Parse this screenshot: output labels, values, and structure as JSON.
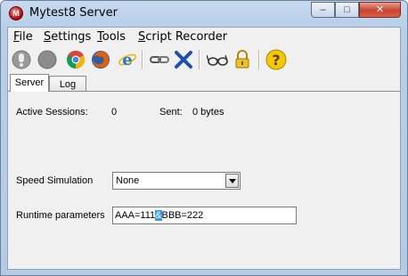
{
  "window": {
    "title": "Mytest8 Server",
    "icon_letter": "M",
    "controls": {
      "minimize": "–",
      "maximize": "□",
      "close": "✕"
    }
  },
  "menu": [
    {
      "key": "F",
      "rest": "ile"
    },
    {
      "key": "S",
      "rest": "ettings"
    },
    {
      "key": "T",
      "rest": "ools"
    },
    {
      "key": "S",
      "rest": "cript Recorder"
    }
  ],
  "toolbar": {
    "icons": [
      "stop-icon",
      "record-icon",
      "chrome-icon",
      "firefox-icon",
      "ie-icon",
      "link-icon",
      "delete-icon",
      "glasses-icon",
      "lock-icon",
      "help-icon"
    ]
  },
  "tabs": {
    "server": "Server",
    "log": "Log"
  },
  "server": {
    "active_sessions_label": "Active Sessions:",
    "active_sessions_value": "0",
    "sent_label": "Sent:",
    "sent_value": "0 bytes",
    "speed_label": "Speed Simulation",
    "speed_value": "None",
    "runtime_label": "Runtime parameters",
    "runtime_before": "AAA=111",
    "runtime_selected": "&",
    "runtime_after": "BBB=222"
  },
  "colors": {
    "selection": "#3399ff",
    "close_button": "#c7422b"
  }
}
